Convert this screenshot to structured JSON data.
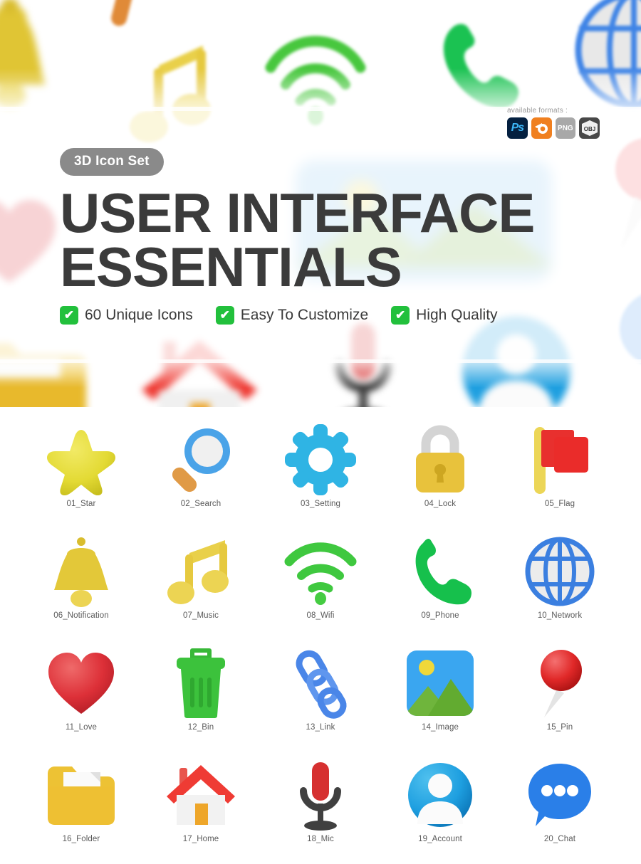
{
  "hero": {
    "badge": "3D Icon Set",
    "title_line_1": "USER INTERFACE",
    "title_line_2": "ESSENTIALS",
    "formats_label": "available formats :",
    "formats": [
      {
        "name": "photoshop-format-badge",
        "label": "Ps"
      },
      {
        "name": "blender-format-badge",
        "label": ""
      },
      {
        "name": "png-format-badge",
        "label": "PNG"
      },
      {
        "name": "obj-format-badge",
        "label": "OBJ"
      }
    ],
    "features": [
      {
        "check": "✔",
        "label": "60 Unique Icons"
      },
      {
        "check": "✔",
        "label": "Easy To Customize"
      },
      {
        "check": "✔",
        "label": "High Quality"
      }
    ]
  },
  "colors": {
    "badge_bg": "#8a8a8a",
    "title": "#3b3b3b",
    "check_green": "#22c03c",
    "label_grey": "#5a5a5a",
    "star_yellow": "#e3da34",
    "search_blue": "#4aa3e8",
    "search_handle_orange": "#e09a46",
    "gear_cyan": "#2fb4e4",
    "lock_yellow": "#e8c23c",
    "lock_shackle_grey": "#d8d8d8",
    "flag_red": "#e8302e",
    "flag_pole_yellow": "#ecd657",
    "bell_yellow": "#e3c839",
    "music_yellow": "#e8cc3c",
    "wifi_green": "#3fc83f",
    "phone_green": "#16c04c",
    "network_blue": "#3b7fe0",
    "love_red": "#dd3038",
    "bin_green": "#3cc23c",
    "link_blue": "#4a86e8",
    "image_sky": "#3aa6f0",
    "image_hill": "#62ab30",
    "image_sun": "#efd83a",
    "pin_red": "#e02828",
    "folder_yellow": "#eec033",
    "home_roof_red": "#ef3b34",
    "home_wall_white": "#f2f2f2",
    "home_door_orange": "#eea62a",
    "mic_red": "#d63030",
    "mic_stand_dark": "#404040",
    "account_blue": "#1e9fe0",
    "chat_blue": "#2a7fe8"
  },
  "icons": [
    {
      "id": "01",
      "label": "01_Star",
      "name": "star-icon"
    },
    {
      "id": "02",
      "label": "02_Search",
      "name": "search-icon"
    },
    {
      "id": "03",
      "label": "03_Setting",
      "name": "setting-icon"
    },
    {
      "id": "04",
      "label": "04_Lock",
      "name": "lock-icon"
    },
    {
      "id": "05",
      "label": "05_Flag",
      "name": "flag-icon"
    },
    {
      "id": "06",
      "label": "06_Notification",
      "name": "notification-icon"
    },
    {
      "id": "07",
      "label": "07_Music",
      "name": "music-icon"
    },
    {
      "id": "08",
      "label": "08_Wifi",
      "name": "wifi-icon"
    },
    {
      "id": "09",
      "label": "09_Phone",
      "name": "phone-icon"
    },
    {
      "id": "10",
      "label": "10_Network",
      "name": "network-icon"
    },
    {
      "id": "11",
      "label": "11_Love",
      "name": "love-icon"
    },
    {
      "id": "12",
      "label": "12_Bin",
      "name": "bin-icon"
    },
    {
      "id": "13",
      "label": "13_Link",
      "name": "link-icon"
    },
    {
      "id": "14",
      "label": "14_Image",
      "name": "image-icon"
    },
    {
      "id": "15",
      "label": "15_Pin",
      "name": "pin-icon"
    },
    {
      "id": "16",
      "label": "16_Folder",
      "name": "folder-icon"
    },
    {
      "id": "17",
      "label": "17_Home",
      "name": "home-icon"
    },
    {
      "id": "18",
      "label": "18_Mic",
      "name": "mic-icon"
    },
    {
      "id": "19",
      "label": "19_Account",
      "name": "account-icon"
    },
    {
      "id": "20",
      "label": "20_Chat",
      "name": "chat-icon"
    }
  ],
  "background_decor": [
    "bell-icon",
    "music-icon",
    "wifi-icon",
    "phone-icon",
    "network-icon",
    "love-icon",
    "image-icon",
    "pin-icon",
    "chat-icon",
    "folder-icon",
    "home-icon",
    "mic-icon",
    "account-icon"
  ]
}
